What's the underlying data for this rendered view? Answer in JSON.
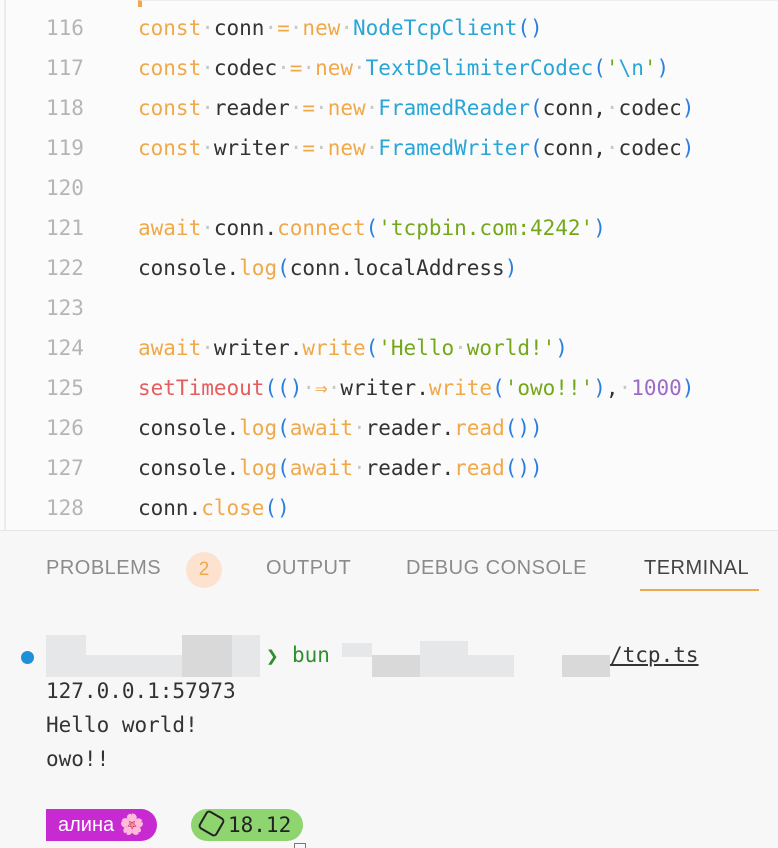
{
  "editor": {
    "lines": [
      {
        "num": "116",
        "segs": [
          [
            "k",
            "const"
          ],
          [
            "dot",
            "·"
          ],
          [
            "t",
            "conn"
          ],
          [
            "dot",
            "·"
          ],
          [
            "k",
            "="
          ],
          [
            "dot",
            "·"
          ],
          [
            "k",
            "new"
          ],
          [
            "dot",
            "·"
          ],
          [
            "cls",
            "NodeTcpClient"
          ],
          [
            "p",
            "()"
          ]
        ]
      },
      {
        "num": "117",
        "segs": [
          [
            "k",
            "const"
          ],
          [
            "dot",
            "·"
          ],
          [
            "t",
            "codec"
          ],
          [
            "dot",
            "·"
          ],
          [
            "k",
            "="
          ],
          [
            "dot",
            "·"
          ],
          [
            "k",
            "new"
          ],
          [
            "dot",
            "·"
          ],
          [
            "cls",
            "TextDelimiterCodec"
          ],
          [
            "p",
            "("
          ],
          [
            "str",
            "'"
          ],
          [
            "cls",
            "\\n"
          ],
          [
            "str",
            "'"
          ],
          [
            "p",
            ")"
          ]
        ]
      },
      {
        "num": "118",
        "segs": [
          [
            "k",
            "const"
          ],
          [
            "dot",
            "·"
          ],
          [
            "t",
            "reader"
          ],
          [
            "dot",
            "·"
          ],
          [
            "k",
            "="
          ],
          [
            "dot",
            "·"
          ],
          [
            "k",
            "new"
          ],
          [
            "dot",
            "·"
          ],
          [
            "cls",
            "FramedReader"
          ],
          [
            "p",
            "("
          ],
          [
            "t",
            "conn,"
          ],
          [
            "dot",
            "·"
          ],
          [
            "t",
            "codec"
          ],
          [
            "p",
            ")"
          ]
        ]
      },
      {
        "num": "119",
        "segs": [
          [
            "k",
            "const"
          ],
          [
            "dot",
            "·"
          ],
          [
            "t",
            "writer"
          ],
          [
            "dot",
            "·"
          ],
          [
            "k",
            "="
          ],
          [
            "dot",
            "·"
          ],
          [
            "k",
            "new"
          ],
          [
            "dot",
            "·"
          ],
          [
            "cls",
            "FramedWriter"
          ],
          [
            "p",
            "("
          ],
          [
            "t",
            "conn,"
          ],
          [
            "dot",
            "·"
          ],
          [
            "t",
            "codec"
          ],
          [
            "p",
            ")"
          ]
        ]
      },
      {
        "num": "120",
        "segs": []
      },
      {
        "num": "121",
        "segs": [
          [
            "k",
            "await"
          ],
          [
            "dot",
            "·"
          ],
          [
            "t",
            "conn."
          ],
          [
            "fn",
            "connect"
          ],
          [
            "p",
            "("
          ],
          [
            "str",
            "'tcpbin.com:4242'"
          ],
          [
            "p",
            ")"
          ]
        ]
      },
      {
        "num": "122",
        "segs": [
          [
            "t",
            "console."
          ],
          [
            "fn",
            "log"
          ],
          [
            "p",
            "("
          ],
          [
            "t",
            "conn.localAddress"
          ],
          [
            "p",
            ")"
          ]
        ]
      },
      {
        "num": "123",
        "segs": []
      },
      {
        "num": "124",
        "segs": [
          [
            "k",
            "await"
          ],
          [
            "dot",
            "·"
          ],
          [
            "t",
            "writer."
          ],
          [
            "fn",
            "write"
          ],
          [
            "p",
            "("
          ],
          [
            "str",
            "'Hello"
          ],
          [
            "dot",
            "·"
          ],
          [
            "str",
            "world!'"
          ],
          [
            "p",
            ")"
          ]
        ]
      },
      {
        "num": "125",
        "segs": [
          [
            "red",
            "setTimeout"
          ],
          [
            "p",
            "(()"
          ],
          [
            "dot",
            "·"
          ],
          [
            "k",
            "⇒"
          ],
          [
            "dot",
            "·"
          ],
          [
            "t",
            "writer."
          ],
          [
            "fn",
            "write"
          ],
          [
            "p",
            "("
          ],
          [
            "str",
            "'owo!!'"
          ],
          [
            "p",
            ")"
          ],
          [
            "t",
            ","
          ],
          [
            "dot",
            "·"
          ],
          [
            "num",
            "1000"
          ],
          [
            "p",
            ")"
          ]
        ]
      },
      {
        "num": "126",
        "segs": [
          [
            "t",
            "console."
          ],
          [
            "fn",
            "log"
          ],
          [
            "p",
            "("
          ],
          [
            "k",
            "await"
          ],
          [
            "dot",
            "·"
          ],
          [
            "t",
            "reader."
          ],
          [
            "fn",
            "read"
          ],
          [
            "p",
            "())"
          ]
        ]
      },
      {
        "num": "127",
        "segs": [
          [
            "t",
            "console."
          ],
          [
            "fn",
            "log"
          ],
          [
            "p",
            "("
          ],
          [
            "k",
            "await"
          ],
          [
            "dot",
            "·"
          ],
          [
            "t",
            "reader."
          ],
          [
            "fn",
            "read"
          ],
          [
            "p",
            "())"
          ]
        ]
      },
      {
        "num": "128",
        "segs": [
          [
            "t",
            "conn."
          ],
          [
            "fn",
            "close"
          ],
          [
            "p",
            "()"
          ]
        ]
      }
    ]
  },
  "panel": {
    "tabs": {
      "problems": "PROBLEMS",
      "problems_count": "2",
      "output": "OUTPUT",
      "debug_console": "DEBUG CONSOLE",
      "terminal": "TERMINAL"
    },
    "terminal": {
      "prompt_arrow": "❯",
      "command": "bun",
      "path_tail": "/tcp.ts",
      "output_lines": [
        "127.0.0.1:57973",
        "Hello world!",
        "owo!!"
      ],
      "user_label": "алина 🌸",
      "node_version": "18.12"
    }
  },
  "colors": {
    "accent": "#f0a94a",
    "keyword": "#f0a94a",
    "class": "#2aa5d6",
    "string": "#74a81b",
    "number": "#9b6cc5",
    "user_pill": "#c82ad2",
    "node_pill": "#8ed46f"
  },
  "icons": {
    "status_dot": "blue-dot-icon",
    "node": "nodejs-hexagon-icon"
  }
}
